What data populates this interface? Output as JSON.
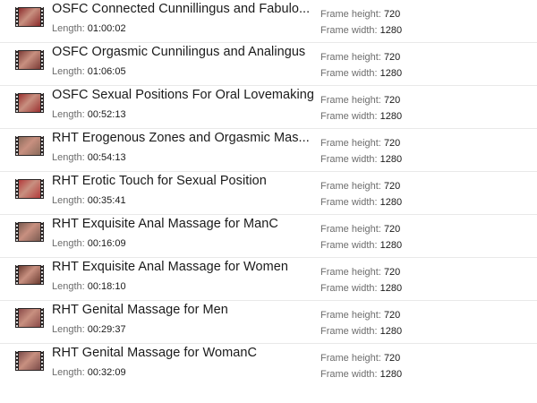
{
  "labels": {
    "length": "Length:",
    "frame_height": "Frame height:",
    "frame_width": "Frame width:"
  },
  "items": [
    {
      "title": "OSFC Connected Cunnillingus and Fabulo...",
      "length": "01:00:02",
      "frame_height": "720",
      "frame_width": "1280",
      "thumb_color": "#8a2a2a",
      "thumb_icon": "video-thumbnail"
    },
    {
      "title": "OSFC Orgasmic Cunnilingus and Analingus",
      "length": "01:06:05",
      "frame_height": "720",
      "frame_width": "1280",
      "thumb_color": "#7a3a35",
      "thumb_icon": "video-thumbnail"
    },
    {
      "title": "OSFC Sexual Positions For Oral Lovemaking",
      "length": "00:52:13",
      "frame_height": "720",
      "frame_width": "1280",
      "thumb_color": "#9a3030",
      "thumb_icon": "video-thumbnail"
    },
    {
      "title": "RHT Erogenous Zones and Orgasmic Mas...",
      "length": "00:54:13",
      "frame_height": "720",
      "frame_width": "1280",
      "thumb_color": "#8a6a5a",
      "thumb_icon": "video-thumbnail"
    },
    {
      "title": "RHT Erotic Touch for Sexual Position",
      "length": "00:35:41",
      "frame_height": "720",
      "frame_width": "1280",
      "thumb_color": "#b23a3a",
      "thumb_icon": "video-thumbnail"
    },
    {
      "title": "RHT Exquisite Anal Massage for ManC",
      "length": "00:16:09",
      "frame_height": "720",
      "frame_width": "1280",
      "thumb_color": "#7a5a50",
      "thumb_icon": "video-thumbnail"
    },
    {
      "title": "RHT Exquisite Anal Massage for Women",
      "length": "00:18:10",
      "frame_height": "720",
      "frame_width": "1280",
      "thumb_color": "#6a3a30",
      "thumb_icon": "video-thumbnail"
    },
    {
      "title": "RHT Genital Massage for Men",
      "length": "00:29:37",
      "frame_height": "720",
      "frame_width": "1280",
      "thumb_color": "#8a4a48",
      "thumb_icon": "video-thumbnail"
    },
    {
      "title": "RHT Genital Massage for WomanC",
      "length": "00:32:09",
      "frame_height": "720",
      "frame_width": "1280",
      "thumb_color": "#7a4a48",
      "thumb_icon": "video-thumbnail"
    }
  ]
}
